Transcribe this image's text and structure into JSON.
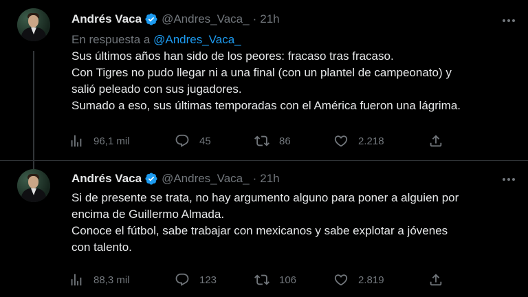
{
  "tweets": [
    {
      "author": {
        "name": "Andrés Vaca",
        "handle": "@Andres_Vaca_",
        "verified": true
      },
      "time": "21h",
      "reply_to": {
        "prefix": "En respuesta a",
        "mention": "@Andres_Vaca_"
      },
      "lines": [
        "Sus últimos años han sido de los peores: fracaso tras fracaso.",
        "Con Tigres no pudo llegar ni a una final (con un plantel de campeonato) y",
        "salió peleado con sus jugadores.",
        "Sumado a eso, sus últimas temporadas con el América fueron una lágrima."
      ],
      "stats": {
        "views": "96,1 mil",
        "replies": "45",
        "retweets": "86",
        "likes": "2.218"
      }
    },
    {
      "author": {
        "name": "Andrés Vaca",
        "handle": "@Andres_Vaca_",
        "verified": true
      },
      "time": "21h",
      "lines": [
        "Si de presente se trata, no hay argumento alguno para poner a alguien por",
        "encima de Guillermo Almada.",
        "Conoce el fútbol, sabe trabajar con mexicanos y sabe explotar a jóvenes",
        "con talento."
      ],
      "stats": {
        "views": "88,3 mil",
        "replies": "123",
        "retweets": "106",
        "likes": "2.819"
      }
    }
  ],
  "icons": {
    "verified": "verified-badge-icon",
    "views": "bar-chart-icon",
    "reply": "speech-bubble-icon",
    "retweet": "retweet-arrows-icon",
    "like": "heart-icon",
    "share": "share-upload-icon",
    "more": "more-dots-icon"
  },
  "colors": {
    "background": "#000000",
    "text": "#e7e9ea",
    "muted": "#71767b",
    "accent": "#1d9bf0"
  }
}
